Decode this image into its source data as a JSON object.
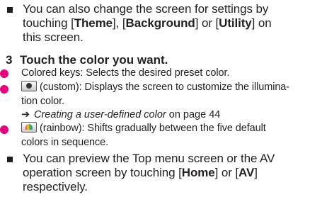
{
  "bullet1": {
    "line1": "You can also change the screen for settings by",
    "line2_pre": "touching [",
    "theme": "Theme",
    "mid1": "], [",
    "background": "Background",
    "mid2": "] or [",
    "utility": "Utility",
    "line2_post": "] on",
    "line3": "this screen."
  },
  "step": {
    "number": "3",
    "title": "Touch the color you want."
  },
  "items": {
    "colored_keys": "Colored keys: Selects the desired preset color.",
    "custom_line1": "(custom): Displays the screen to customize the illumina-",
    "custom_line2": "tion color.",
    "reference_arrow": "➔",
    "reference_title": "Creating a user-defined color",
    "reference_page": " on page 44",
    "rainbow_line1": "(rainbow): Shifts gradually between the five default",
    "rainbow_line2": "colors in sequence."
  },
  "bullet2": {
    "line1": "You can preview the Top menu screen or the AV",
    "line2": "operation screen by touching [",
    "home": "Home",
    "mid": "] or [",
    "av": "AV",
    "line2_post": "]",
    "line3": "respectively."
  },
  "colors": {
    "text": "#231f20",
    "accent_dot": "#e6007e"
  },
  "icons": {
    "bullet": "square-bullet-icon",
    "item_marker": "magenta-dot-icon",
    "custom_key": "custom-color-key-icon",
    "rainbow_key": "rainbow-key-icon",
    "reference": "arrow-reference-icon"
  }
}
